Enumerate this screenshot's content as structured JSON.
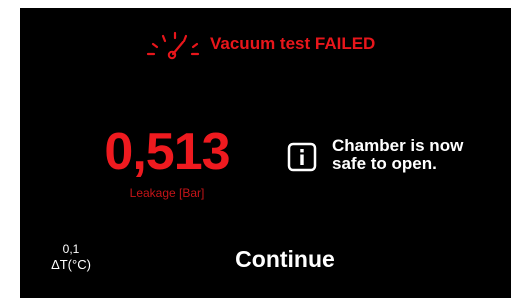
{
  "header": {
    "icon": "vacuum-gauge-icon",
    "title": "Vacuum test FAILED",
    "color": "#e8161b"
  },
  "leakage": {
    "value": "0,513",
    "label": "Leakage [Bar]",
    "color": "#ef1a1f"
  },
  "info": {
    "icon": "info-icon",
    "line1": "Chamber is now",
    "line2": "safe to open."
  },
  "delta_t": {
    "value": "0,1",
    "label": "ΔT(°C)"
  },
  "actions": {
    "continue_label": "Continue"
  }
}
